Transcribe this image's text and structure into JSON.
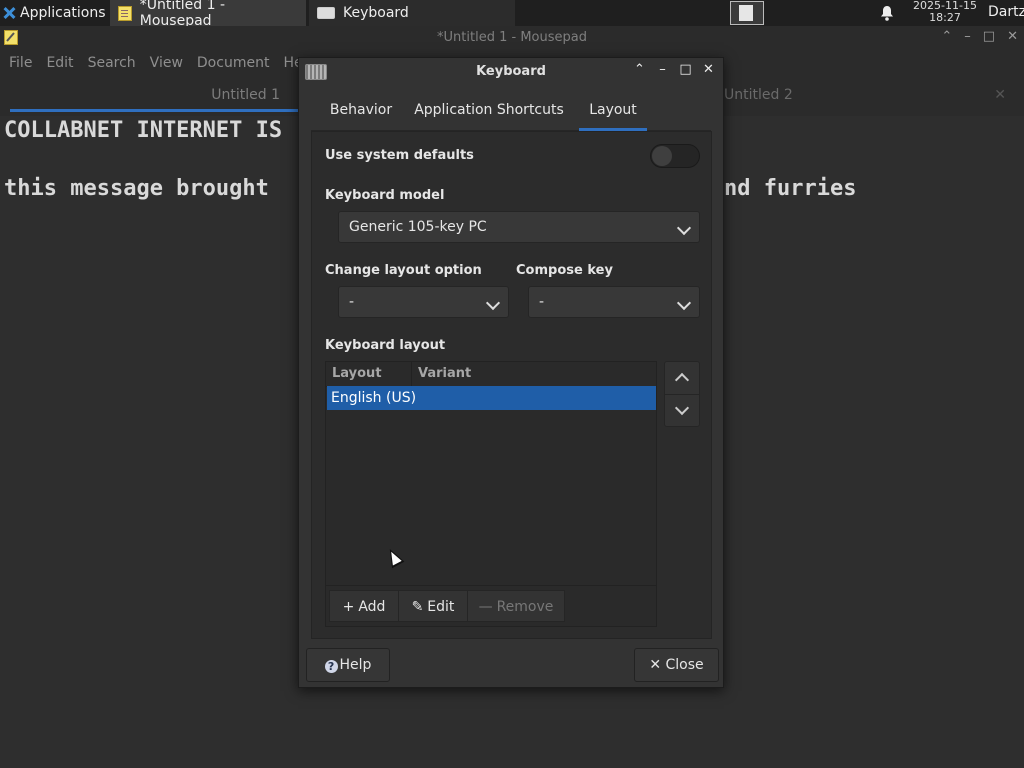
{
  "panel": {
    "applications_label": "Applications",
    "tasks": [
      {
        "label": "*Untitled 1 - Mousepad",
        "icon": "note-icon"
      },
      {
        "label": "Keyboard",
        "icon": "keyboard-icon"
      }
    ],
    "clock_date": "2025-11-15",
    "clock_time": "18:27",
    "user": "Dartz"
  },
  "mousepad": {
    "title": "*Untitled 1 - Mousepad",
    "menu": [
      "File",
      "Edit",
      "Search",
      "View",
      "Document",
      "He"
    ],
    "tabs": [
      "Untitled 1",
      "Untitled 2"
    ],
    "lines": [
      "COLLABNET INTERNET IS",
      "this message brought",
      "nd furries"
    ]
  },
  "dialog": {
    "title": "Keyboard",
    "tabs": [
      "Behavior",
      "Application Shortcuts",
      "Layout"
    ],
    "active_tab": "Layout",
    "use_system_defaults_label": "Use system defaults",
    "use_system_defaults_on": false,
    "keyboard_model_label": "Keyboard model",
    "keyboard_model_value": "Generic 105-key PC",
    "change_layout_label": "Change layout option",
    "change_layout_value": "-",
    "compose_key_label": "Compose key",
    "compose_key_value": "-",
    "keyboard_layout_label": "Keyboard layout",
    "columns": [
      "Layout",
      "Variant"
    ],
    "rows": [
      {
        "layout": "English (US)",
        "variant": ""
      }
    ],
    "add_label": "Add",
    "edit_label": "Edit",
    "remove_label": "Remove",
    "help_label": "Help",
    "close_label": "Close"
  },
  "colors": {
    "accent": "#2f6fbf",
    "selection": "#1f5ea8"
  }
}
